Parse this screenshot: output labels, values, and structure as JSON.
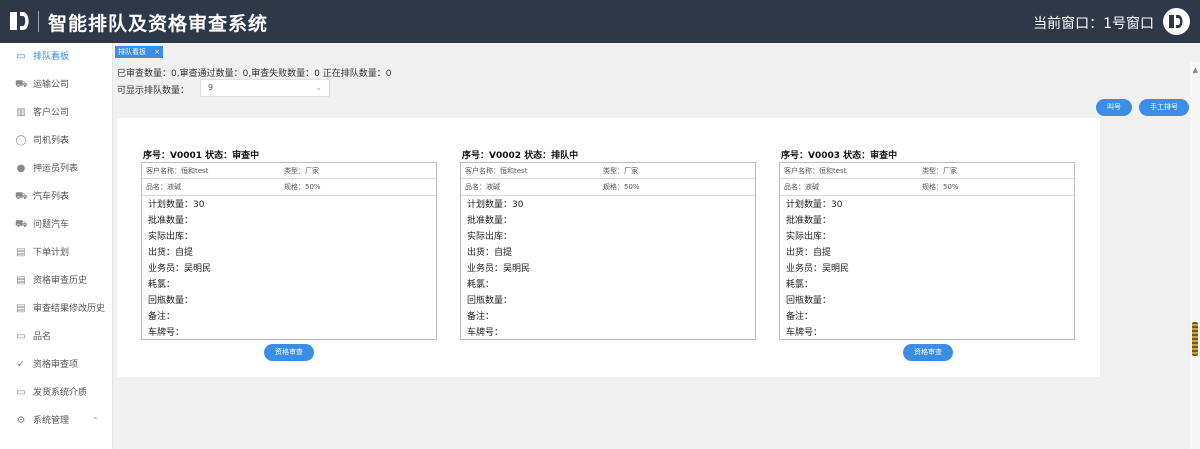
{
  "header": {
    "title": "智能排队及资格审查系统",
    "window_label": "当前窗口：1号窗口"
  },
  "sidebar": {
    "items": [
      {
        "label": "排队看板",
        "icon": "▭"
      },
      {
        "label": "运输公司",
        "icon": "⛟"
      },
      {
        "label": "客户公司",
        "icon": "▥"
      },
      {
        "label": "司机列表",
        "icon": "◯"
      },
      {
        "label": "押运员列表",
        "icon": "●"
      },
      {
        "label": "汽车列表",
        "icon": "⛟"
      },
      {
        "label": "问题汽车",
        "icon": "⛟"
      },
      {
        "label": "下单计划",
        "icon": "▤"
      },
      {
        "label": "资格审查历史",
        "icon": "▤"
      },
      {
        "label": "审查结果修改历史",
        "icon": "▤"
      },
      {
        "label": "品名",
        "icon": "▭"
      },
      {
        "label": "资格审查项",
        "icon": "✓"
      },
      {
        "label": "发货系统介质",
        "icon": "▭"
      },
      {
        "label": "系统管理",
        "icon": "⚙",
        "chevron": "⌃"
      }
    ]
  },
  "tab": {
    "label": "排队看板",
    "close": "×"
  },
  "stats": {
    "text": "已审查数量：0,审查通过数量：0,审查失败数量：0 正在排队数量：0"
  },
  "queue": {
    "label": "可显示排队数量：",
    "value": "9",
    "arrow": "⌄"
  },
  "buttons": {
    "call": "叫号",
    "manual": "手工排号",
    "review": "资格审查"
  },
  "cards": [
    {
      "title": "序号：V0001 状态：审查中",
      "customer": "客户名称：恒和test",
      "type": "类型：厂家",
      "product": "品名：液碱",
      "spec": "规格：50%",
      "details": [
        "计划数量：30",
        "批准数量：",
        "实际出库：",
        "出货：自提",
        "业务员：吴明民",
        "耗氯：",
        "回瓶数量：",
        "备注：",
        "车牌号："
      ]
    },
    {
      "title": "序号：V0002 状态：排队中",
      "customer": "客户名称：恒和test",
      "type": "类型：厂家",
      "product": "品名：液碱",
      "spec": "规格：50%",
      "details": [
        "计划数量：30",
        "批准数量：",
        "实际出库：",
        "出货：自提",
        "业务员：吴明民",
        "耗氯：",
        "回瓶数量：",
        "备注：",
        "车牌号："
      ]
    },
    {
      "title": "序号：V0003 状态：审查中",
      "customer": "客户名称：恒和test",
      "type": "类型：厂家",
      "product": "品名：液碱",
      "spec": "规格：50%",
      "details": [
        "计划数量：30",
        "批准数量：",
        "实际出库：",
        "出货：自提",
        "业务员：吴明民",
        "耗氯：",
        "回瓶数量：",
        "备注：",
        "车牌号："
      ]
    }
  ],
  "colors": {
    "header": "#2e3849",
    "accent": "#3a8ee6",
    "panel": "#ffffff",
    "background": "#f0f0f0"
  }
}
